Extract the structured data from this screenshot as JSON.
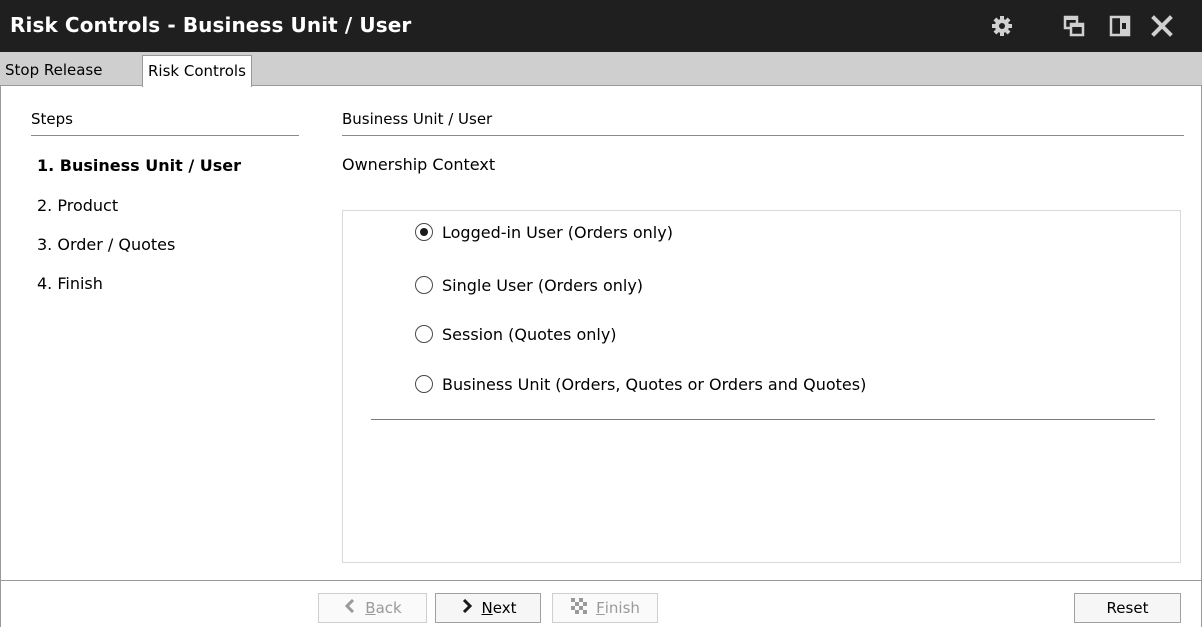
{
  "window": {
    "title": "Risk Controls - Business Unit / User",
    "icons": [
      "gear-icon",
      "restore-icon",
      "dock-icon",
      "close-icon"
    ]
  },
  "tabs": [
    {
      "label": "Stop Release",
      "active": false
    },
    {
      "label": "Risk Controls",
      "active": true
    }
  ],
  "steps": {
    "header": "Steps",
    "items": [
      {
        "label": "1. Business Unit / User",
        "current": true
      },
      {
        "label": "2. Product",
        "current": false
      },
      {
        "label": "3. Order / Quotes",
        "current": false
      },
      {
        "label": "4. Finish",
        "current": false
      }
    ]
  },
  "main": {
    "header": "Business Unit / User",
    "subheader": "Ownership Context",
    "options": [
      {
        "label": "Logged-in User (Orders only)",
        "checked": true
      },
      {
        "label": "Single User (Orders only)",
        "checked": false
      },
      {
        "label": "Session (Quotes only)",
        "checked": false
      },
      {
        "label": "Business Unit (Orders, Quotes or Orders and Quotes)",
        "checked": false
      }
    ]
  },
  "footer": {
    "back": {
      "prefix": "",
      "mnemonic": "B",
      "rest": "ack",
      "enabled": false
    },
    "next": {
      "prefix": "",
      "mnemonic": "N",
      "rest": "ext",
      "enabled": true
    },
    "finish": {
      "prefix": "",
      "mnemonic": "F",
      "rest": "inish",
      "enabled": false
    },
    "reset": {
      "label": "Reset",
      "enabled": true
    }
  },
  "colors": {
    "titlebar": "#1f1f1f",
    "tabstrip": "#cfcfcf",
    "disabled_text": "#9a9a9a"
  }
}
